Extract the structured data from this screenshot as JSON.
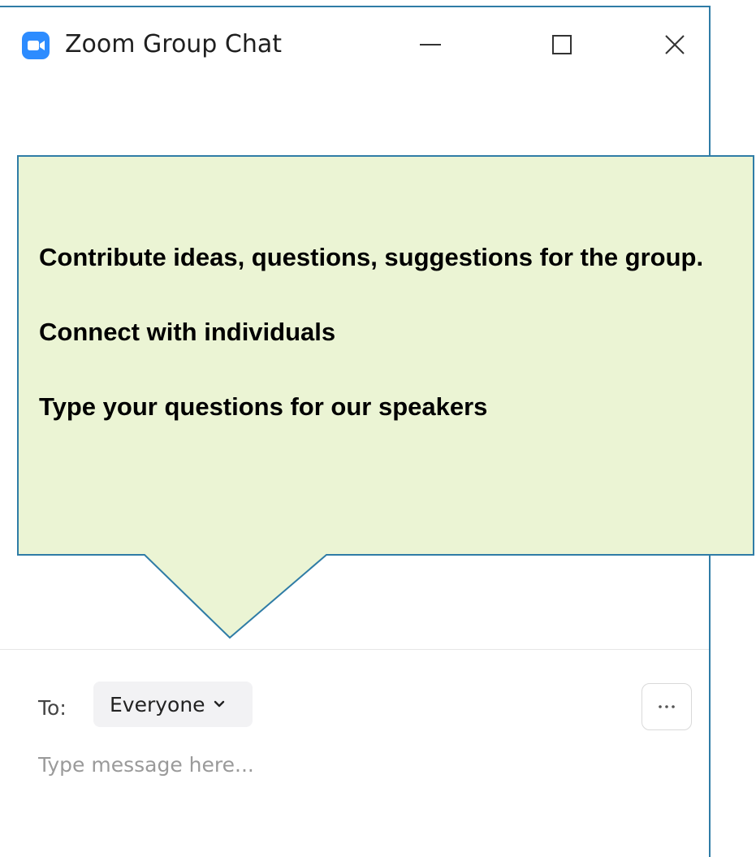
{
  "window": {
    "title": "Zoom Group Chat",
    "controls": [
      "minimize-icon",
      "maximize-icon",
      "close-icon"
    ]
  },
  "callout": {
    "lines": [
      "Contribute ideas, questions, suggestions for the group.",
      "Connect with individuals",
      "Type your questions for our speakers"
    ],
    "fill_color": "#ebf4d4",
    "border_color": "#2f7ca6"
  },
  "chat": {
    "to_label": "To:",
    "recipient": "Everyone",
    "more_icon": "ellipsis-icon",
    "message_placeholder": "Type message here..."
  },
  "colors": {
    "accent": "#2d8cff",
    "window_border": "#2f7ca6"
  }
}
